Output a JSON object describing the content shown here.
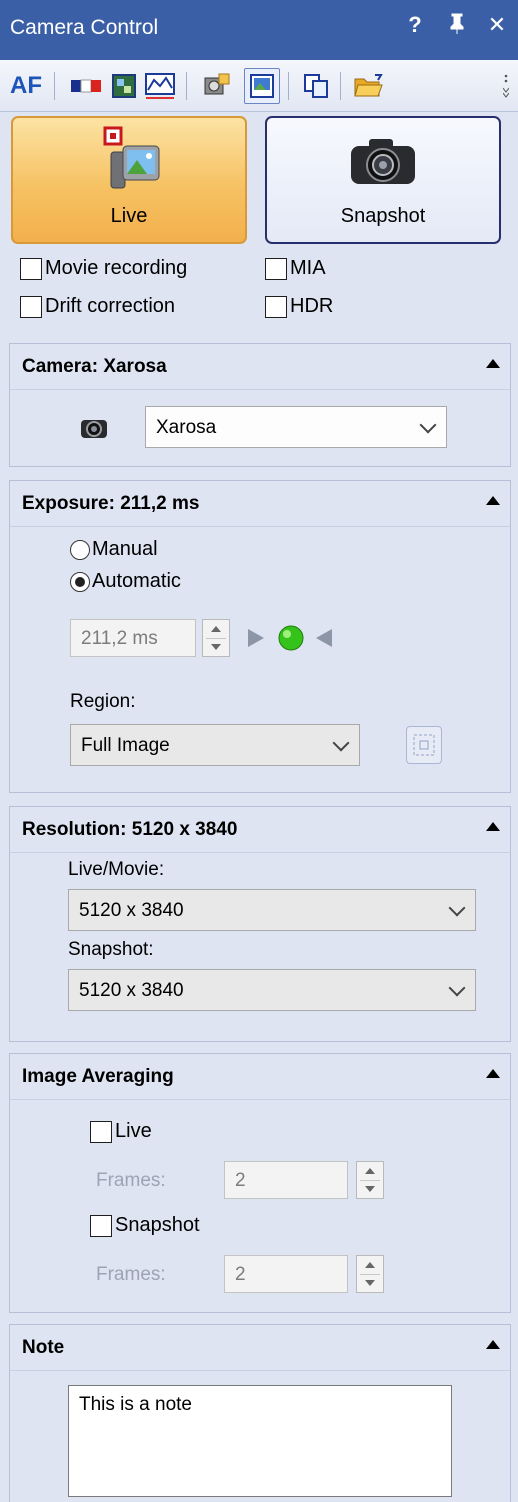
{
  "window": {
    "title": "Camera Control",
    "help_button": "?",
    "pin_button": "Ⅱ",
    "close_button": "✕"
  },
  "toolbar": {
    "af_label": "AF",
    "icons": [
      "color-bars-icon",
      "image-adjust-icon",
      "histogram-icon",
      "camera-settings-icon",
      "live-view-icon",
      "copy-image-icon",
      "open-folder-icon"
    ]
  },
  "mode_buttons": {
    "live_label": "Live",
    "snapshot_label": "Snapshot"
  },
  "options": {
    "movie_recording": "Movie recording",
    "drift_correction": "Drift correction",
    "mia": "MIA",
    "hdr": "HDR"
  },
  "camera_section": {
    "title": "Camera: Xarosa",
    "selected_camera": "Xarosa"
  },
  "exposure_section": {
    "title": "Exposure: 211,2 ms",
    "manual_label": "Manual",
    "automatic_label": "Automatic",
    "selected_mode": "Automatic",
    "exposure_value": "211,2 ms",
    "region_label": "Region:",
    "region_value": "Full Image",
    "indicator_color": "#35c21a"
  },
  "resolution_section": {
    "title": "Resolution: 5120 x 3840",
    "live_movie_label": "Live/Movie:",
    "live_movie_value": "5120 x 3840",
    "snapshot_label": "Snapshot:",
    "snapshot_value": "5120 x 3840"
  },
  "averaging_section": {
    "title": "Image Averaging",
    "live_label": "Live",
    "live_frames_label": "Frames:",
    "live_frames_value": "2",
    "snapshot_label": "Snapshot",
    "snapshot_frames_label": "Frames:",
    "snapshot_frames_value": "2"
  },
  "note_section": {
    "title": "Note",
    "note_text": "This is a note"
  },
  "colors": {
    "title_bar": "#3a5fa6",
    "panel_bg": "#dfe4f2",
    "live_button": "#f6c263",
    "accent_blue": "#1d56b8"
  }
}
